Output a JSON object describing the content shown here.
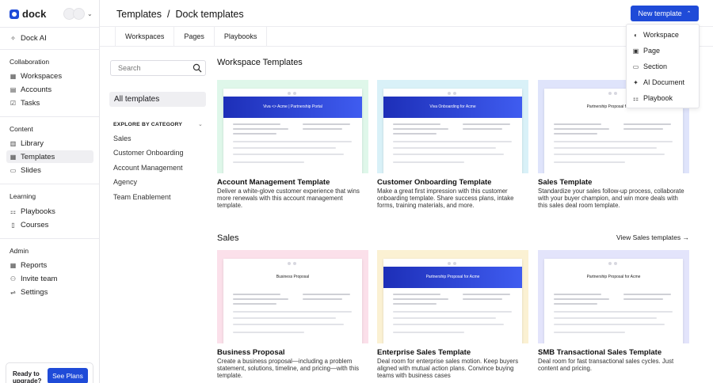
{
  "app": {
    "logo": "dock"
  },
  "sidebar": {
    "dock_ai": "Dock AI",
    "sections": [
      {
        "label": "Collaboration",
        "items": [
          "Workspaces",
          "Accounts",
          "Tasks"
        ]
      },
      {
        "label": "Content",
        "items": [
          "Library",
          "Templates",
          "Slides"
        ]
      },
      {
        "label": "Learning",
        "items": [
          "Playbooks",
          "Courses"
        ]
      },
      {
        "label": "Admin",
        "items": [
          "Reports",
          "Invite team",
          "Settings"
        ]
      }
    ],
    "active_item": "Templates",
    "upgrade_text": "Ready to upgrade?",
    "see_plans": "See Plans"
  },
  "header": {
    "crumb_root": "Templates",
    "crumb_sep": "/",
    "crumb_current": "Dock templates",
    "new_template": "New template"
  },
  "tabs": [
    "Workspaces",
    "Pages",
    "Playbooks"
  ],
  "new_menu": [
    {
      "label": "Workspace",
      "icon": "workspace-icon"
    },
    {
      "label": "Page",
      "icon": "page-icon"
    },
    {
      "label": "Section",
      "icon": "folder-icon"
    },
    {
      "label": "AI Document",
      "icon": "sparkle-icon"
    },
    {
      "label": "Playbook",
      "icon": "playbook-icon"
    }
  ],
  "filters": {
    "search_placeholder": "Search",
    "all_templates": "All templates",
    "category_heading": "EXPLORE BY CATEGORY",
    "categories": [
      "Sales",
      "Customer Onboarding",
      "Account Management",
      "Agency",
      "Team Enablement"
    ]
  },
  "workspace_templates": {
    "title": "Workspace Templates",
    "cards": [
      {
        "title": "Account Management Template",
        "desc": "Deliver a white-glove customer experience that wins more renewals with this account management template.",
        "band": "Viva <> Acme | Partnership Portal",
        "bg": "#dff7ea",
        "band_style": "blue"
      },
      {
        "title": "Customer Onboarding Template",
        "desc": "Make a great first impression with this customer onboarding template. Share success plans, intake forms, training materials, and more.",
        "band": "Viva Onboarding for Acme",
        "bg": "#d9f1f8",
        "band_style": "blue"
      },
      {
        "title": "Sales Template",
        "desc": "Standardize your sales follow-up process, collaborate with your buyer champion, and win more deals with this sales deal room template.",
        "band": "Partnership Proposal for Acme",
        "bg": "#dfe4fb",
        "band_style": "white"
      }
    ]
  },
  "sales_templates": {
    "title": "Sales",
    "view_link": "View Sales templates →",
    "cards": [
      {
        "title": "Business Proposal",
        "desc": "Create a business proposal—including a problem statement, solutions, timeline, and pricing—with this template.",
        "band": "Business Proposal",
        "bg": "#fbe0ea",
        "band_style": "white"
      },
      {
        "title": "Enterprise Sales Template",
        "desc": "Deal room for enterprise sales motion. Keep buyers aligned with mutual action plans. Convince buying teams with business cases",
        "band": "Partnership Proposal for Acme",
        "bg": "#fbf1d3",
        "band_style": "blue"
      },
      {
        "title": "SMB Transactional Sales Template",
        "desc": "Deal room for fast transactional sales cycles. Just content and pricing.",
        "band": "Partnership Proposal for Acme",
        "bg": "#e3e4fb",
        "band_style": "white"
      }
    ]
  },
  "colors": {
    "accent": "#1f4bd8",
    "active_bg": "#efeff2"
  }
}
